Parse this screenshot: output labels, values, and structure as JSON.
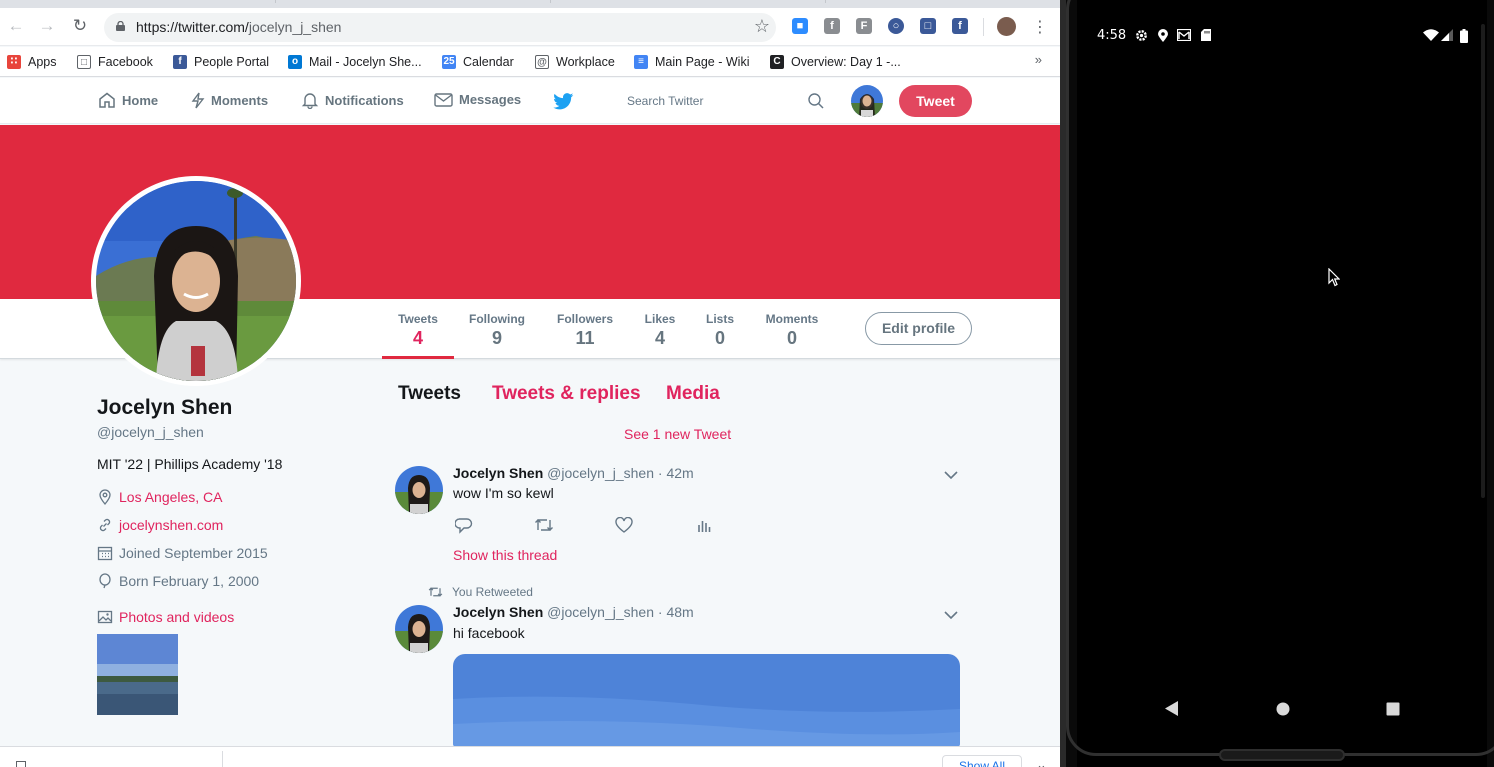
{
  "browser": {
    "url_host": "https://twitter.com/",
    "url_path": "jocelyn_j_shen",
    "bookmarks": [
      {
        "label": "Apps",
        "icon": "apps-grid-icon",
        "color": "#e8453c"
      },
      {
        "label": "Facebook",
        "icon": "folder-icon",
        "color": "#5f6368"
      },
      {
        "label": "People Portal",
        "icon": "facebook-icon",
        "color": "#3b5998"
      },
      {
        "label": "Mail - Jocelyn She...",
        "icon": "outlook-icon",
        "color": "#0078d4"
      },
      {
        "label": "Calendar",
        "icon": "calendar-icon",
        "color": "#4285f4"
      },
      {
        "label": "Workplace",
        "icon": "workplace-icon",
        "color": "#5f6368"
      },
      {
        "label": "Main Page - Wiki",
        "icon": "document-icon",
        "color": "#4285f4"
      },
      {
        "label": "Overview: Day 1 -...",
        "icon": "c-logo-icon",
        "color": "#202124"
      }
    ],
    "bookmarks_more": "»",
    "calendar_day": "25"
  },
  "twitter": {
    "nav": {
      "home": "Home",
      "moments": "Moments",
      "notifications": "Notifications",
      "messages": "Messages",
      "search_placeholder": "Search Twitter",
      "tweet_button": "Tweet"
    },
    "colors": {
      "accent": "#e0245e",
      "banner": "#e0293f",
      "tweet_button": "#e2475f",
      "twitter_blue": "#1da1f2"
    },
    "stats": [
      {
        "label": "Tweets",
        "value": "4",
        "active": true
      },
      {
        "label": "Following",
        "value": "9"
      },
      {
        "label": "Followers",
        "value": "11"
      },
      {
        "label": "Likes",
        "value": "4"
      },
      {
        "label": "Lists",
        "value": "0"
      },
      {
        "label": "Moments",
        "value": "0"
      }
    ],
    "edit_profile": "Edit profile",
    "profile": {
      "name": "Jocelyn Shen",
      "handle": "@jocelyn_j_shen",
      "bio": "MIT '22 | Phillips Academy '18",
      "location": "Los Angeles, CA",
      "website": "jocelynshen.com",
      "joined": "Joined September 2015",
      "born": "Born February 1, 2000",
      "photos_videos": "Photos and videos"
    },
    "timeline_tabs": [
      {
        "label": "Tweets",
        "active": true
      },
      {
        "label": "Tweets & replies"
      },
      {
        "label": "Media"
      }
    ],
    "new_tweets": "See 1 new Tweet",
    "tweets": [
      {
        "name": "Jocelyn Shen",
        "handle": "@jocelyn_j_shen",
        "time": "· 42m",
        "text": "wow I'm so kewl",
        "show_thread": "Show this thread"
      },
      {
        "name": "Jocelyn Shen",
        "handle": "@jocelyn_j_shen",
        "time": "· 48m",
        "text": "hi facebook",
        "retweeted_label": "You Retweeted"
      }
    ]
  },
  "downloads": {
    "show_all": "Show All"
  },
  "android": {
    "time": "4:58",
    "status_icons": [
      "settings-icon",
      "location-icon",
      "gmail-icon",
      "sd-card-icon",
      "wifi-icon",
      "signal-icon",
      "battery-icon"
    ]
  }
}
